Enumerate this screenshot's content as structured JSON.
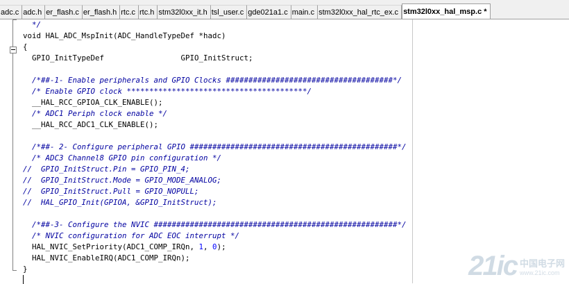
{
  "tabs": [
    {
      "label": "adc.c",
      "active": false
    },
    {
      "label": "adc.h",
      "active": false
    },
    {
      "label": "er_flash.c",
      "active": false
    },
    {
      "label": "er_flash.h",
      "active": false
    },
    {
      "label": "rtc.c",
      "active": false
    },
    {
      "label": "rtc.h",
      "active": false
    },
    {
      "label": "stm32l0xx_it.h",
      "active": false
    },
    {
      "label": "tsl_user.c",
      "active": false
    },
    {
      "label": "gde021a1.c",
      "active": false
    },
    {
      "label": "main.c",
      "active": false
    },
    {
      "label": "stm32l0xx_hal_rtc_ex.c",
      "active": false
    },
    {
      "label": "stm32l0xx_hal_msp.c *",
      "active": true
    }
  ],
  "code_lines": [
    [
      {
        "t": "  */",
        "c": "cm"
      }
    ],
    [
      {
        "t": "void HAL_ADC_MspInit(ADC_HandleTypeDef *hadc)",
        "c": ""
      }
    ],
    [
      {
        "t": "{",
        "c": ""
      }
    ],
    [
      {
        "t": "  GPIO_InitTypeDef                 GPIO_InitStruct;",
        "c": ""
      }
    ],
    [],
    [
      {
        "t": "  /*##-1- Enable peripherals and GPIO Clocks #####################################*/",
        "c": "cm"
      }
    ],
    [
      {
        "t": "  /* Enable GPIO clock ****************************************/",
        "c": "cm"
      }
    ],
    [
      {
        "t": "  __HAL_RCC_GPIOA_CLK_ENABLE();",
        "c": ""
      }
    ],
    [
      {
        "t": "  /* ADC1 Periph clock enable */",
        "c": "cm"
      }
    ],
    [
      {
        "t": "  __HAL_RCC_ADC1_CLK_ENABLE();",
        "c": ""
      }
    ],
    [],
    [
      {
        "t": "  /*##- 2- Configure peripheral GPIO ##############################################*/",
        "c": "cm"
      }
    ],
    [
      {
        "t": "  /* ADC3 Channel8 GPIO pin configuration */",
        "c": "cm"
      }
    ],
    [
      {
        "t": "//  GPIO_InitStruct.Pin = GPIO_PIN_4;",
        "c": "cm"
      }
    ],
    [
      {
        "t": "//  GPIO_InitStruct.Mode = GPIO_MODE_ANALOG;",
        "c": "cm"
      }
    ],
    [
      {
        "t": "//  GPIO_InitStruct.Pull = GPIO_NOPULL;",
        "c": "cm"
      }
    ],
    [
      {
        "t": "//  HAL_GPIO_Init(GPIOA, &GPIO_InitStruct);",
        "c": "cm"
      }
    ],
    [],
    [
      {
        "t": "  /*##-3- Configure the NVIC ######################################################*/",
        "c": "cm"
      }
    ],
    [
      {
        "t": "  /* NVIC configuration for ADC EOC interrupt */",
        "c": "cm"
      }
    ],
    [
      {
        "t": "  HAL_NVIC_SetPriority(ADC1_COMP_IRQn, ",
        "c": ""
      },
      {
        "t": "1",
        "c": "num"
      },
      {
        "t": ", ",
        "c": ""
      },
      {
        "t": "0",
        "c": "num"
      },
      {
        "t": ");",
        "c": ""
      }
    ],
    [
      {
        "t": "  HAL_NVIC_EnableIRQ(ADC1_COMP_IRQn);",
        "c": ""
      }
    ],
    [
      {
        "t": "}",
        "c": ""
      }
    ]
  ],
  "colors": {
    "comment": "#0000a0",
    "number": "#0000ff",
    "text": "#000000"
  },
  "watermark": {
    "logo": "21ic",
    "title": "中国电子网",
    "url": "www.21ic.com"
  }
}
